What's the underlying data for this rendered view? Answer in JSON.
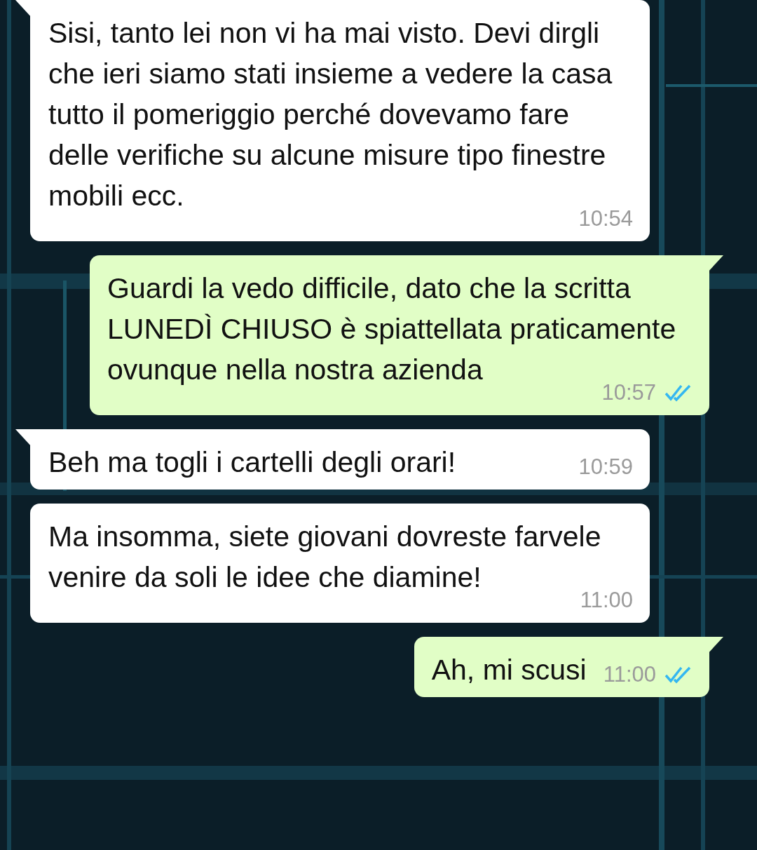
{
  "messages": [
    {
      "kind": "incoming",
      "tail": true,
      "text": "Sisi, tanto lei non vi ha mai visto. Devi dirgli che ieri siamo stati insieme a vedere la casa tutto il pomeriggio perché dovevamo fare delle verifiche su alcune misure tipo finestre mobili ecc.",
      "time": "10:54"
    },
    {
      "kind": "outgoing",
      "tail": true,
      "text": "Guardi la vedo difficile, dato che la scritta LUNEDÌ CHIUSO è spiattellata praticamente ovunque nella nostra azienda",
      "time": "10:57",
      "read": true
    },
    {
      "kind": "incoming",
      "tail": true,
      "text": "Beh ma togli i cartelli degli orari!",
      "time": "10:59"
    },
    {
      "kind": "incoming",
      "tail": false,
      "text": "Ma insomma, siete giovani dovreste farvele venire da soli le idee che diamine!",
      "time": "11:00"
    },
    {
      "kind": "outgoing",
      "tail": true,
      "text": "Ah, mi scusi",
      "time": "11:00",
      "read": true
    }
  ]
}
